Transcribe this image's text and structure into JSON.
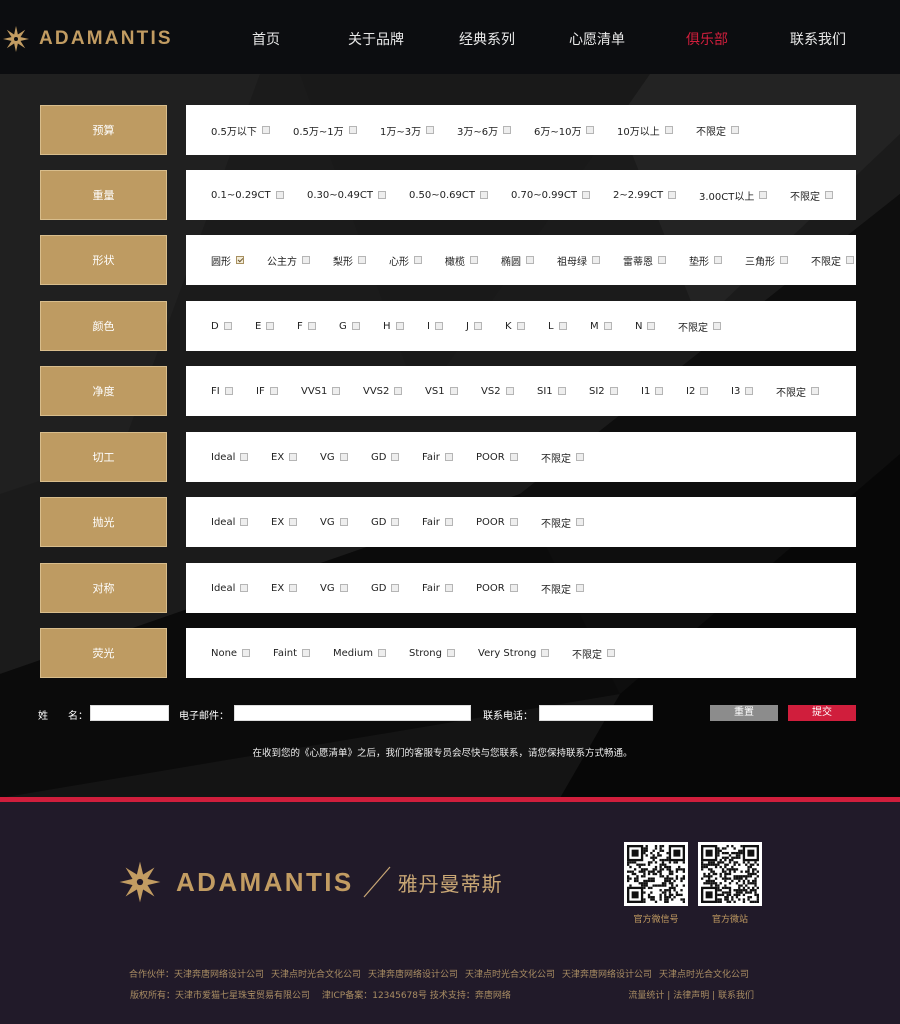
{
  "brand": {
    "name": "ADAMANTIS",
    "name_cn": "雅丹曼蒂斯",
    "gold": "#c29c62",
    "accent_red": "#d01e3c"
  },
  "nav": [
    {
      "label": "首页",
      "active": false
    },
    {
      "label": "关于品牌",
      "active": false
    },
    {
      "label": "经典系列",
      "active": false
    },
    {
      "label": "心愿清单",
      "active": false
    },
    {
      "label": "俱乐部",
      "active": true
    },
    {
      "label": "联系我们",
      "active": false
    }
  ],
  "filters": [
    {
      "label": "预算",
      "options": [
        "0.5万以下",
        "0.5万~1万",
        "1万~3万",
        "3万~6万",
        "6万~10万",
        "10万以上",
        "不限定"
      ],
      "checked": []
    },
    {
      "label": "重量",
      "options": [
        "0.1~0.29CT",
        "0.30~0.49CT",
        "0.50~0.69CT",
        "0.70~0.99CT",
        "2~2.99CT",
        "3.00CT以上",
        "不限定"
      ],
      "checked": []
    },
    {
      "label": "形状",
      "options": [
        "圆形",
        "公主方",
        "梨形",
        "心形",
        "橄榄",
        "椭圆",
        "祖母绿",
        "雷蒂恩",
        "垫形",
        "三角形",
        "不限定"
      ],
      "checked": [
        "圆形"
      ]
    },
    {
      "label": "颜色",
      "options": [
        "D",
        "E",
        "F",
        "G",
        "H",
        "I",
        "J",
        "K",
        "L",
        "M",
        "N",
        "不限定"
      ],
      "checked": []
    },
    {
      "label": "净度",
      "options": [
        "FI",
        "IF",
        "VVS1",
        "VVS2",
        "VS1",
        "VS2",
        "SI1",
        "SI2",
        "I1",
        "I2",
        "I3",
        "不限定"
      ],
      "checked": []
    },
    {
      "label": "切工",
      "options": [
        "Ideal",
        "EX",
        "VG",
        "GD",
        "Fair",
        "POOR",
        "不限定"
      ],
      "checked": []
    },
    {
      "label": "抛光",
      "options": [
        "Ideal",
        "EX",
        "VG",
        "GD",
        "Fair",
        "POOR",
        "不限定"
      ],
      "checked": []
    },
    {
      "label": "对称",
      "options": [
        "Ideal",
        "EX",
        "VG",
        "GD",
        "Fair",
        "POOR",
        "不限定"
      ],
      "checked": []
    },
    {
      "label": "荧光",
      "options": [
        "None",
        "Faint",
        "Medium",
        "Strong",
        "Very Strong",
        "不限定"
      ],
      "checked": []
    }
  ],
  "form": {
    "name_label": "姓　　名：",
    "name_value": "",
    "email_label": "电子邮件：",
    "email_value": "",
    "phone_label": "联系电话：",
    "phone_value": "",
    "reset_label": "重置",
    "submit_label": "提交",
    "notice": "在收到您的《心愿清单》之后，我们的客服专员会尽快与您联系，请您保持联系方式畅通。"
  },
  "footer": {
    "qr": [
      {
        "label": "官方微信号",
        "icon": "qr-code-icon"
      },
      {
        "label": "官方微站",
        "icon": "qr-code-icon"
      }
    ],
    "partners_label": "合作伙伴：",
    "partners": [
      "天津奔唐网络设计公司",
      "天津点时光合文化公司",
      "天津奔唐网络设计公司",
      "天津点时光合文化公司",
      "天津奔唐网络设计公司",
      "天津点时光合文化公司"
    ],
    "copyright": "版权所有：天津市爱猫七星珠宝贸易有限公司　 津ICP备案：12345678号 技术支持：奔唐网络",
    "links": [
      "流量统计",
      "法律声明",
      "联系我们"
    ]
  }
}
